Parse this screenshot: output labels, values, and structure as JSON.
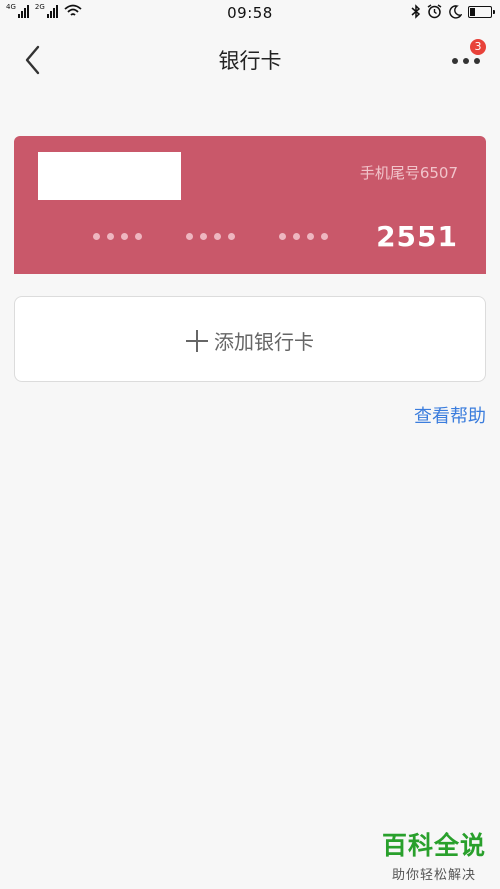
{
  "status_bar": {
    "network_1": "4G",
    "network_2": "2G",
    "time": "09:58",
    "battery_level": 0.25,
    "icons": [
      "signal-icon",
      "wifi-icon",
      "bluetooth-icon",
      "alarm-icon",
      "moon-icon",
      "battery-icon"
    ]
  },
  "nav": {
    "title": "银行卡",
    "badge_count": "3",
    "icons": [
      "chevron-left-icon",
      "more-icon"
    ]
  },
  "card": {
    "phone_tail": "手机尾号6507",
    "card_tail": "2551",
    "card_color": "#c9586a"
  },
  "add_card": {
    "label": "添加银行卡",
    "icon": "plus-icon"
  },
  "help": {
    "label": "查看帮助",
    "color": "#3b7ddd"
  },
  "watermark": {
    "title": "百科全说",
    "subtitle": "助你轻松解决",
    "color": "#29a02c"
  }
}
